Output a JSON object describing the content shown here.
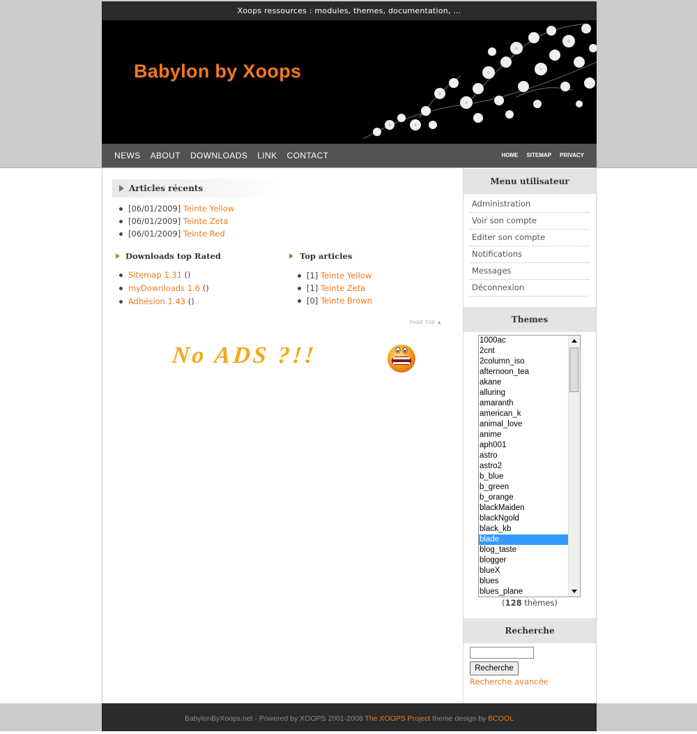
{
  "header": {
    "tagline": "Xoops ressources : modules, themes, documentation, ...",
    "site_title": "Babylon by Xoops"
  },
  "nav": {
    "main": [
      "NEWS",
      "ABOUT",
      "DOWNLOADS",
      "LINK",
      "CONTACT"
    ],
    "secondary": [
      "HOME",
      "SITEMAP",
      "PRIVACY"
    ]
  },
  "recent_articles": {
    "title": "Articles récents",
    "items": [
      {
        "date": "[06/01/2009]",
        "link": "Teinte Yellow"
      },
      {
        "date": "[06/01/2009]",
        "link": "Teinte Zeta"
      },
      {
        "date": "[06/01/2009]",
        "link": "Teinte Red"
      }
    ]
  },
  "downloads_top": {
    "title": "Downloads top Rated",
    "items": [
      {
        "link": "Sitemap 1.31",
        "suffix": "()"
      },
      {
        "link": "myDownloads 1.6",
        "suffix": "()"
      },
      {
        "link": "Adhésion 1.43",
        "suffix": "()"
      }
    ]
  },
  "top_articles": {
    "title": "Top articles",
    "items": [
      {
        "count": "[1]",
        "link": "Teinte Yellow"
      },
      {
        "count": "[1]",
        "link": "Teinte Zeta"
      },
      {
        "count": "[0]",
        "link": "Teinte Brown"
      }
    ]
  },
  "page_top": "PAGE TOP",
  "ad_text": "No ADS ?!!",
  "user_menu": {
    "title": "Menu utilisateur",
    "items": [
      "Administration",
      "Voir son compte",
      "Editer son compte",
      "Notifications",
      "Messages",
      "Déconnexion"
    ]
  },
  "themes": {
    "title": "Themes",
    "options": [
      "1000ac",
      "2cnt",
      "2column_iso",
      "afternoon_tea",
      "akane",
      "alluring",
      "amaranth",
      "american_k",
      "animal_love",
      "anime",
      "aph001",
      "astro",
      "astro2",
      "b_blue",
      "b_green",
      "b_orange",
      "blackMaiden",
      "blackNgold",
      "black_kb",
      "blade",
      "blog_taste",
      "blogger",
      "blueX",
      "blues",
      "blues_plane"
    ],
    "selected": "blade",
    "count_prefix": "(",
    "count": "128",
    "count_suffix": " thèmes)"
  },
  "search": {
    "title": "Recherche",
    "input_value": "",
    "button_label": "Recherche",
    "advanced_link": "Recherche avancée"
  },
  "footer": {
    "text_before": "BabylonByXoops.net - Powered by XOOPS 2001-2008 ",
    "link1": "The XOOPS Project",
    "text_mid": " theme design by ",
    "link2": "BCOOL"
  },
  "colors": {
    "accent": "#f07a1a",
    "nav_bg": "#525252",
    "selection": "#3399ff"
  }
}
